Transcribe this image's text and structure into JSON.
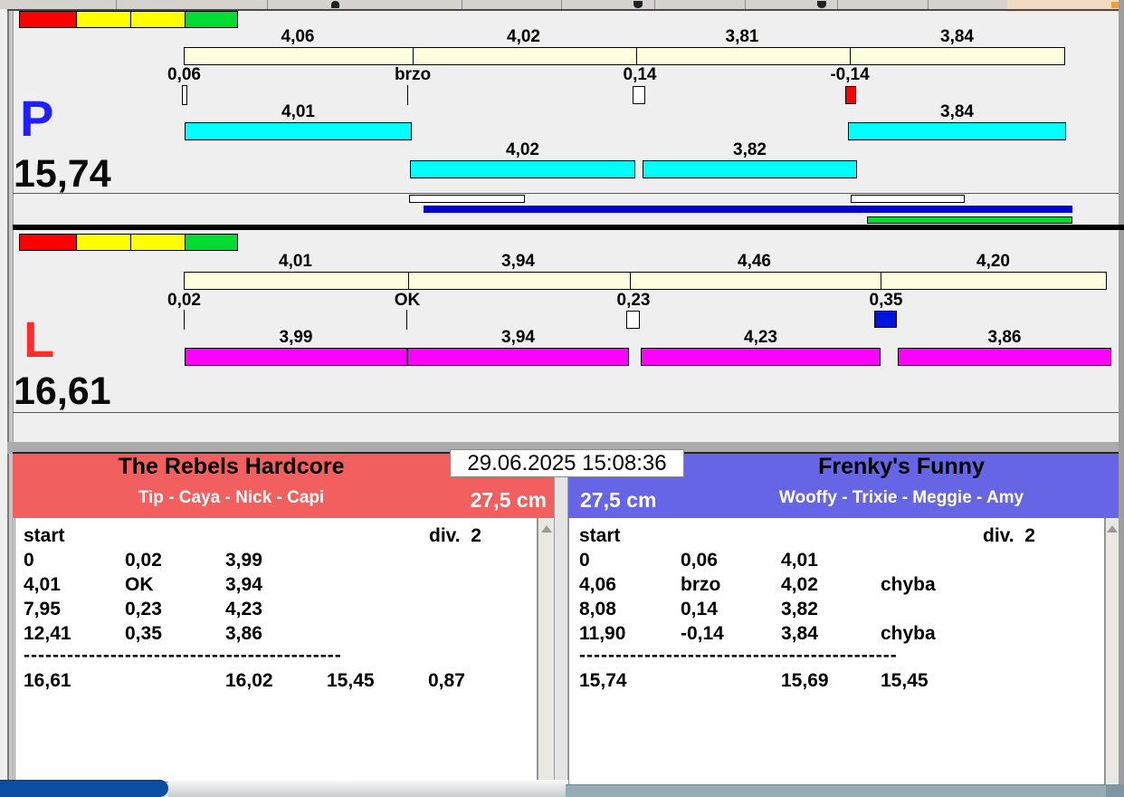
{
  "datetime": "29.06.2025 15:08:36",
  "lane_p": {
    "letter": "P",
    "total": "15,74",
    "splits": [
      "4,06",
      "4,02",
      "3,81",
      "3,84"
    ],
    "marks": [
      "0,06",
      "brzo",
      "0,14",
      "-0,14"
    ],
    "runs_row1": [
      "4,01",
      "3,84"
    ],
    "runs_row2": [
      "4,02",
      "3,82"
    ]
  },
  "lane_l": {
    "letter": "L",
    "total": "16,61",
    "splits": [
      "4,01",
      "3,94",
      "4,46",
      "4,20"
    ],
    "marks": [
      "0,02",
      "OK",
      "0,23",
      "0,35"
    ],
    "runs": [
      "3,99",
      "3,94",
      "4,23",
      "3,86"
    ]
  },
  "team_left": {
    "name": "The Rebels Hardcore",
    "dogs": "Tip - Caya - Nick - Capi",
    "jump_height": "27,5 cm",
    "start_label": "start",
    "division_label": "div.  2",
    "rows": [
      [
        "0",
        "0,02",
        "3,99",
        ""
      ],
      [
        "4,01",
        "OK",
        "3,94",
        ""
      ],
      [
        "7,95",
        "0,23",
        "4,23",
        ""
      ],
      [
        "12,41",
        "0,35",
        "3,86",
        ""
      ]
    ],
    "separator": "--------------------------------------------",
    "totals": [
      "16,61",
      "16,02",
      "15,45",
      "0,87"
    ]
  },
  "team_right": {
    "name": "Frenky's Funny",
    "dogs": "Wooffy - Trixie - Meggie - Amy",
    "jump_height": "27,5 cm",
    "start_label": "start",
    "division_label": "div.  2",
    "rows": [
      [
        "0",
        "0,06",
        "4,01",
        ""
      ],
      [
        "4,06",
        "brzo",
        "4,02",
        "chyba"
      ],
      [
        "8,08",
        "0,14",
        "3,82",
        ""
      ],
      [
        "11,90",
        "-0,14",
        "3,84",
        "chyba"
      ]
    ],
    "separator": "--------------------------------------------",
    "totals": [
      "15,74",
      "15,69",
      "15,45",
      ""
    ]
  },
  "colors": {
    "background": "#efefef",
    "split_bar": "#ffffde",
    "run_bar_p": "#00ffff",
    "run_bar_l": "#ff00ff",
    "progress_blue": "#0000d6",
    "progress_green": "#00dc32",
    "mark_red": "#ff0000",
    "mark_blue": "#0014dc",
    "mark_white": "#ffffff",
    "light_red": "#ff0000",
    "light_yellow": "#ffff00",
    "light_green": "#00dc32",
    "lane_p_letter": "#1f1fff",
    "lane_l_letter": "#ff2d2d",
    "team_left_header": "#f25f5f",
    "team_right_header": "#6565e5",
    "taskbar_blue": "#0a4da2"
  }
}
